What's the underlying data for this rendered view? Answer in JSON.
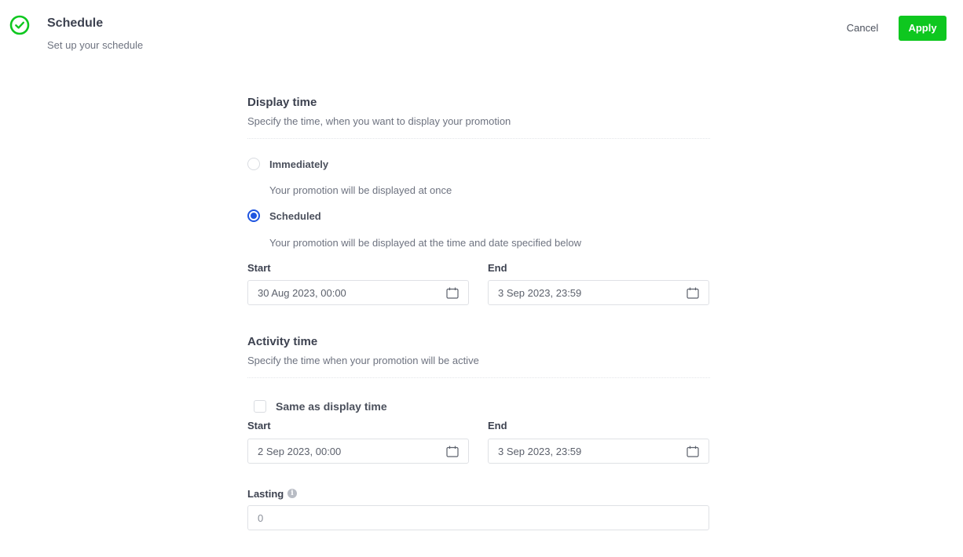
{
  "header": {
    "icon": "check-circle-icon",
    "title": "Schedule",
    "subtitle": "Set up your schedule",
    "cancel_label": "Cancel",
    "apply_label": "Apply",
    "accent_color": "#0ec71f"
  },
  "display_time": {
    "title": "Display time",
    "description": "Specify the time, when you want to display your promotion",
    "options": [
      {
        "label": "Immediately",
        "description": "Your promotion will be displayed at once",
        "selected": false
      },
      {
        "label": "Scheduled",
        "description": "Your promotion will be displayed at the time and date specified below",
        "selected": true
      }
    ],
    "start": {
      "label": "Start",
      "value": "30 Aug 2023, 00:00",
      "icon": "calendar-icon"
    },
    "end": {
      "label": "End",
      "value": "3 Sep 2023, 23:59",
      "icon": "calendar-icon"
    }
  },
  "activity_time": {
    "title": "Activity time",
    "description": "Specify the time when your promotion will be active",
    "same_as_display": {
      "label": "Same as display time",
      "checked": false
    },
    "start": {
      "label": "Start",
      "value": "2 Sep 2023, 00:00",
      "icon": "calendar-icon"
    },
    "end": {
      "label": "End",
      "value": "3 Sep 2023, 23:59",
      "icon": "calendar-icon"
    }
  },
  "lasting": {
    "label": "Lasting",
    "info_icon": "info-icon",
    "placeholder": "0",
    "value": ""
  },
  "colors": {
    "radio_selected": "#1f55e0",
    "apply_button": "#0ec71f"
  }
}
